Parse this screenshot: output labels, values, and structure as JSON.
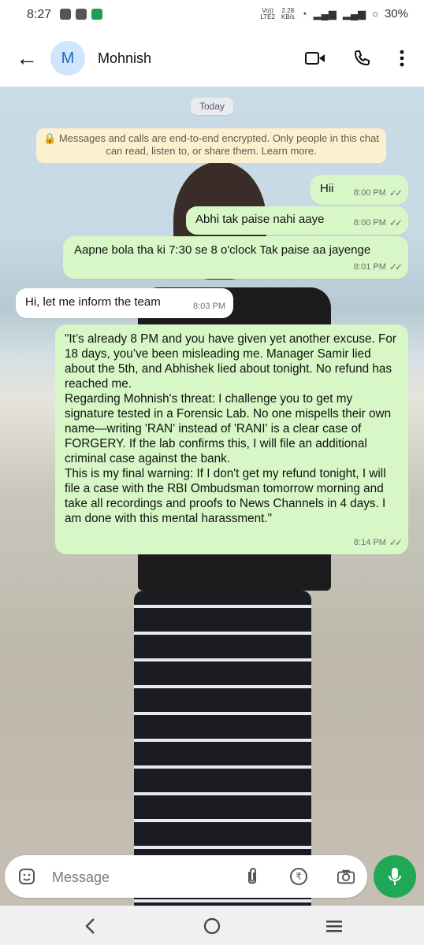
{
  "status": {
    "time": "8:27",
    "volte": "Vo))",
    "lte": "LTE2",
    "speed": "2.28",
    "speed_unit": "KB/s",
    "battery": "30%"
  },
  "header": {
    "avatar_initial": "M",
    "contact_name": "Mohnish"
  },
  "chat": {
    "date_chip": "Today",
    "encryption_notice": "🔒 Messages and calls are end-to-end encrypted. Only people in this chat can read, listen to, or share them. Learn more.",
    "messages": [
      {
        "text": "Hii",
        "time": "8:00 PM"
      },
      {
        "text": "Abhi tak paise nahi aaye",
        "time": "8:00 PM"
      },
      {
        "text": "Aapne bola tha ki 7:30 se 8 o'clock Tak paise aa jayenge",
        "time": "8:01 PM"
      },
      {
        "text": "Hi, let me inform the team",
        "time": "8:03 PM"
      },
      {
        "text": "\"It’s already 8 PM and you have given yet another excuse. For 18 days, you’ve been misleading me. Manager Samir lied about the 5th, and Abhishek lied about tonight. No refund has reached me.\nRegarding Mohnish's threat: I challenge you to get my signature tested in a Forensic Lab. No one mispells their own name—writing 'RAN' instead of 'RANI' is a clear case of FORGERY. If the lab confirms this, I will file an additional criminal case against the bank.\nThis is my final warning: If I don't get my refund tonight, I will file a case with the RBI Ombudsman tomorrow morning and take all recordings and proofs to News Channels in 4 days. I am done with this mental harassment.\"",
        "time": "8:14 PM"
      }
    ]
  },
  "composer": {
    "placeholder": "Message"
  },
  "colors": {
    "outgoing_bubble": "#d7f8c6",
    "incoming_bubble": "#ffffff",
    "accent": "#1fa855"
  }
}
